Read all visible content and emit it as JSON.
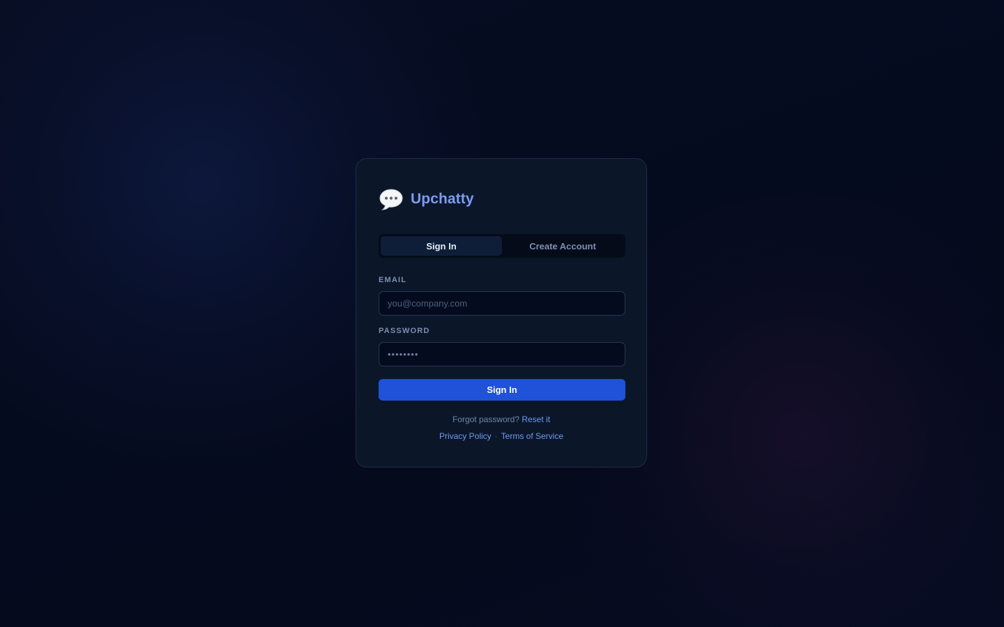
{
  "brand": {
    "name": "Upchatty",
    "icon": "speech-bubble-icon"
  },
  "tabs": [
    {
      "label": "Sign In",
      "active": true
    },
    {
      "label": "Create Account",
      "active": false
    }
  ],
  "form": {
    "email": {
      "label": "EMAIL",
      "placeholder": "you@company.com",
      "value": ""
    },
    "password": {
      "label": "PASSWORD",
      "placeholder": "••••••••",
      "value": ""
    },
    "submit_label": "Sign In"
  },
  "footer": {
    "forgot_text": "Forgot password?",
    "reset_link": "Reset it",
    "privacy_link": "Privacy Policy",
    "separator": "·",
    "terms_link": "Terms of Service"
  },
  "colors": {
    "accent": "#1f51d9",
    "brand": "#7b9cf3",
    "link": "#6f9af5",
    "card_bg": "#0b1629",
    "page_bg": "#060c20"
  }
}
